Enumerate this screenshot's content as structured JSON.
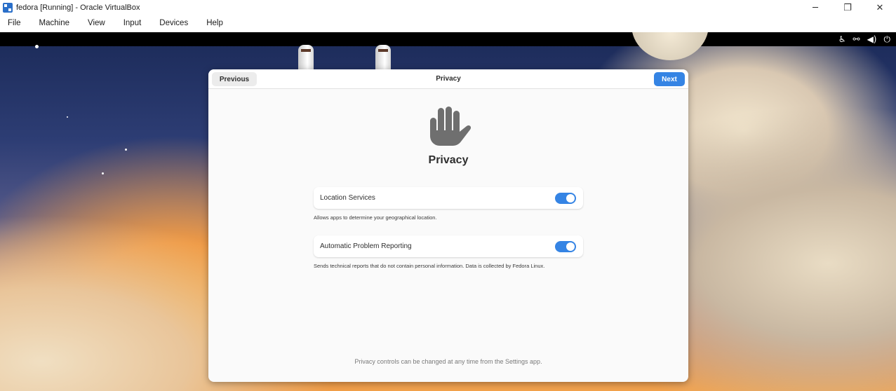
{
  "window": {
    "title": "fedora [Running] - Oracle VirtualBox",
    "controls": {
      "minimize": "─",
      "restore": "❐",
      "close": "✕"
    }
  },
  "menu": [
    "File",
    "Machine",
    "View",
    "Input",
    "Devices",
    "Help"
  ],
  "tray": {
    "accessibility": "♿",
    "network": "⚯",
    "volume": "◀)",
    "power": "⏻"
  },
  "dialog": {
    "previous_label": "Previous",
    "header_title": "Privacy",
    "next_label": "Next",
    "page_title": "Privacy",
    "rows": [
      {
        "label": "Location Services",
        "enabled": true,
        "description": "Allows apps to determine your geographical location."
      },
      {
        "label": "Automatic Problem Reporting",
        "enabled": true,
        "description": "Sends technical reports that do not contain personal information. Data is collected by Fedora Linux."
      }
    ],
    "footer_note": "Privacy controls can be changed at any time from the Settings app."
  },
  "colors": {
    "accent": "#3584e4",
    "dialog_bg": "#fafafa",
    "icon_gray": "#6f6f6f"
  }
}
